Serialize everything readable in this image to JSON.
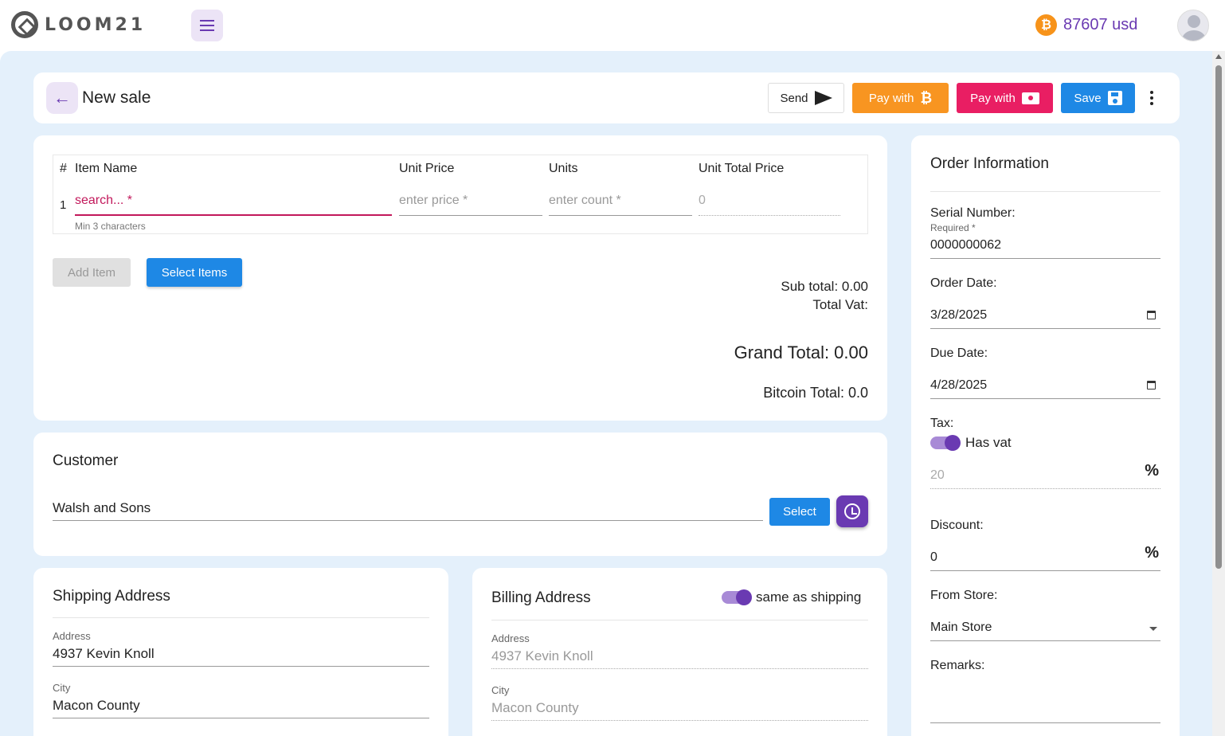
{
  "app": {
    "logo": "LOOM21",
    "balance": "87607 usd",
    "btc_glyph": "₿"
  },
  "header": {
    "title": "New sale",
    "send_label": "Send",
    "pay_btc_label": "Pay with",
    "pay_cash_label": "Pay with",
    "save_label": "Save"
  },
  "items": {
    "columns": [
      "#",
      "Item Name",
      "Unit Price",
      "Units",
      "Unit Total Price"
    ],
    "rows": [
      {
        "num": "1",
        "name_placeholder": "search... *",
        "price_placeholder": "enter price *",
        "units_placeholder": "enter count *",
        "total": "0"
      }
    ],
    "name_hint": "Min 3 characters",
    "add_item_label": "Add Item",
    "select_items_label": "Select Items",
    "sub_total": "Sub total: 0.00",
    "total_vat": "Total Vat:",
    "grand_total": "Grand Total: 0.00",
    "bitcoin_total": "Bitcoin Total: 0.0"
  },
  "customer": {
    "title": "Customer",
    "value": "Walsh and Sons",
    "select_label": "Select"
  },
  "shipping": {
    "title": "Shipping Address",
    "address_label": "Address",
    "address": "4937 Kevin Knoll",
    "city_label": "City",
    "city": "Macon County"
  },
  "billing": {
    "title": "Billing Address",
    "same_label": "same as shipping",
    "same_checked": true,
    "address_label": "Address",
    "address": "4937 Kevin Knoll",
    "city_label": "City",
    "city": "Macon County"
  },
  "order": {
    "title": "Order Information",
    "serial_label": "Serial Number:",
    "serial_sub": "Required *",
    "serial": "0000000062",
    "order_date_label": "Order Date:",
    "order_date": "3/28/2025",
    "due_date_label": "Due Date:",
    "due_date": "4/28/2025",
    "tax_label": "Tax:",
    "has_vat_label": "Has vat",
    "has_vat": true,
    "tax_value": "20",
    "percent": "%",
    "discount_label": "Discount:",
    "discount": "0",
    "store_label": "From Store:",
    "store": "Main Store",
    "remarks_label": "Remarks:"
  },
  "colors": {
    "accent": "#6a3ab2",
    "orange": "#f89521",
    "pink": "#e91e63",
    "blue": "#1e88e5",
    "background": "#e4f0fb"
  }
}
